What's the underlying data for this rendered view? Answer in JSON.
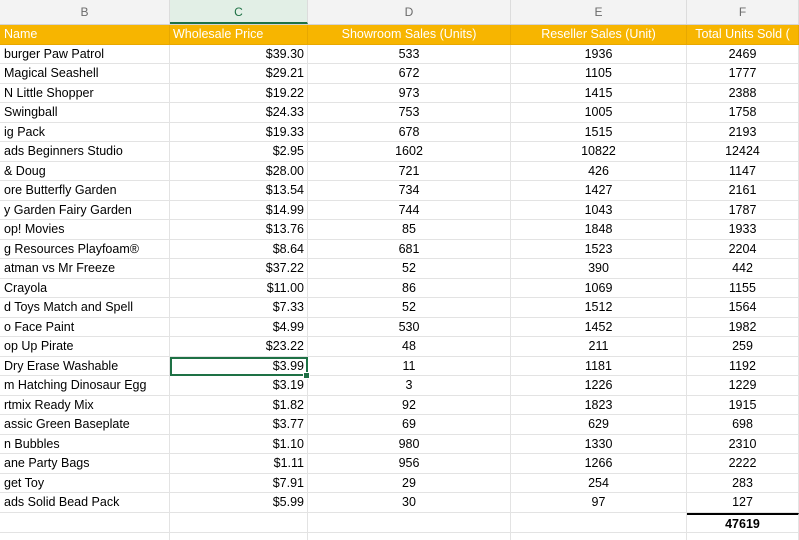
{
  "columns": [
    "B",
    "C",
    "D",
    "E",
    "F"
  ],
  "headers": {
    "b": "Name",
    "c": "Wholesale Price",
    "d": "Showroom Sales (Units)",
    "e": "Reseller Sales (Unit)",
    "f": "Total Units Sold ("
  },
  "rows": [
    {
      "name": "burger Paw Patrol",
      "price": "$39.30",
      "showroom": "533",
      "reseller": "1936",
      "total": "2469"
    },
    {
      "name": " Magical Seashell",
      "price": "$29.21",
      "showroom": "672",
      "reseller": "1105",
      "total": "1777"
    },
    {
      "name": "N Little Shopper",
      "price": "$19.22",
      "showroom": "973",
      "reseller": "1415",
      "total": "2388"
    },
    {
      "name": " Swingball",
      "price": "$24.33",
      "showroom": "753",
      "reseller": "1005",
      "total": "1758"
    },
    {
      "name": "ig Pack",
      "price": "$19.33",
      "showroom": "678",
      "reseller": "1515",
      "total": "2193"
    },
    {
      "name": "ads Beginners Studio",
      "price": "$2.95",
      "showroom": "1602",
      "reseller": "10822",
      "total": "12424"
    },
    {
      "name": " & Doug",
      "price": "$28.00",
      "showroom": "721",
      "reseller": "426",
      "total": "1147"
    },
    {
      "name": "ore Butterfly Garden",
      "price": "$13.54",
      "showroom": "734",
      "reseller": "1427",
      "total": "2161"
    },
    {
      "name": "y Garden Fairy Garden",
      "price": "$14.99",
      "showroom": "744",
      "reseller": "1043",
      "total": "1787"
    },
    {
      "name": "op! Movies",
      "price": "$13.76",
      "showroom": "85",
      "reseller": "1848",
      "total": "1933"
    },
    {
      "name": "g Resources Playfoam®",
      "price": "$8.64",
      "showroom": "681",
      "reseller": "1523",
      "total": "2204"
    },
    {
      "name": "atman vs Mr Freeze",
      "price": "$37.22",
      "showroom": "52",
      "reseller": "390",
      "total": "442"
    },
    {
      "name": " Crayola",
      "price": "$11.00",
      "showroom": "86",
      "reseller": "1069",
      "total": "1155"
    },
    {
      "name": "d Toys Match and Spell",
      "price": "$7.33",
      "showroom": "52",
      "reseller": "1512",
      "total": "1564"
    },
    {
      "name": "o Face Paint",
      "price": "$4.99",
      "showroom": "530",
      "reseller": "1452",
      "total": "1982"
    },
    {
      "name": "op Up Pirate",
      "price": "$23.22",
      "showroom": "48",
      "reseller": "211",
      "total": "259"
    },
    {
      "name": " Dry Erase Washable",
      "price": "$3.99",
      "showroom": "11",
      "reseller": "1181",
      "total": "1192"
    },
    {
      "name": "m Hatching Dinosaur Egg",
      "price": "$3.19",
      "showroom": "3",
      "reseller": "1226",
      "total": "1229"
    },
    {
      "name": "rtmix Ready Mix",
      "price": "$1.82",
      "showroom": "92",
      "reseller": "1823",
      "total": "1915"
    },
    {
      "name": "assic Green Baseplate",
      "price": "$3.77",
      "showroom": "69",
      "reseller": "629",
      "total": "698"
    },
    {
      "name": "n Bubbles",
      "price": "$1.10",
      "showroom": "980",
      "reseller": "1330",
      "total": "2310"
    },
    {
      "name": "ane Party Bags",
      "price": "$1.11",
      "showroom": "956",
      "reseller": "1266",
      "total": "2222"
    },
    {
      "name": "get Toy",
      "price": "$7.91",
      "showroom": "29",
      "reseller": "254",
      "total": "283"
    },
    {
      "name": "ads Solid Bead Pack",
      "price": "$5.99",
      "showroom": "30",
      "reseller": "97",
      "total": "127"
    }
  ],
  "grand_total": "47619",
  "colors": {
    "header_fill": "#f7b500",
    "selection": "#1e7145"
  }
}
